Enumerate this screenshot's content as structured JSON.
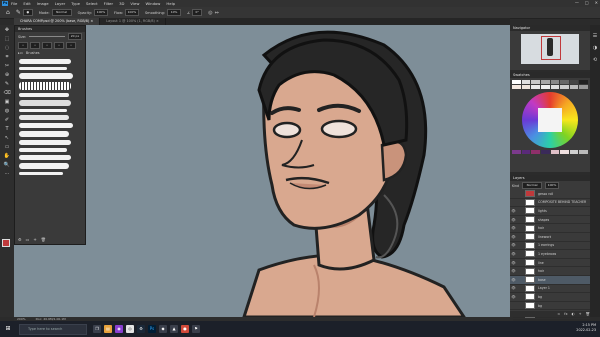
{
  "app": {
    "logo": "Ps",
    "menu": [
      "File",
      "Edit",
      "Image",
      "Layer",
      "Type",
      "Select",
      "Filter",
      "3D",
      "View",
      "Window",
      "Help"
    ],
    "window_controls": [
      "—",
      "□",
      "✕"
    ]
  },
  "options": {
    "mode_label": "Mode:",
    "mode_value": "Normal",
    "opacity_label": "Opacity:",
    "opacity_value": "100%",
    "flow_label": "Flow:",
    "flow_value": "100%",
    "smoothing_label": "Smoothing:",
    "smoothing_value": "10%",
    "angle_value": "0°"
  },
  "document_tabs": [
    {
      "label": "CHARA COMP.psd @ 200% (base, RGB/8) ×",
      "active": true
    },
    {
      "label": "Layout 1 @ 100% (1, RGB/8) ×",
      "active": false
    }
  ],
  "toolbar": [
    "✥",
    "⬚",
    "◌",
    "⌗",
    "✂",
    "⊕",
    "✎",
    "⌫",
    "▣",
    "◍",
    "✐",
    "T",
    "↖",
    "▭",
    "✋",
    "🔍",
    "⋯"
  ],
  "brushes_panel": {
    "title": "Brushes",
    "size_label": "Size:",
    "size_value": "20 px",
    "folder_label": "Brushes",
    "preset_count": 8
  },
  "navigator": {
    "title": "Navigator"
  },
  "swatches": {
    "title": "Swatches"
  },
  "layers": {
    "title": "Layers",
    "kind_label": "Kind",
    "blend_value": "Normal",
    "opacity_value": "100%",
    "rows": [
      {
        "name": "gesso roll",
        "eye": false,
        "color": "#c0393b"
      },
      {
        "name": "COMPOSITE BEHIND TEACHER",
        "eye": false,
        "color": "#4a4a4a"
      },
      {
        "name": "lights",
        "eye": true,
        "color": "#3a3a3a"
      },
      {
        "name": "shapes",
        "eye": true,
        "color": "#3a3a3a"
      },
      {
        "name": "hair",
        "eye": true,
        "color": "#3a3a3a"
      },
      {
        "name": "linework",
        "eye": true,
        "color": "#3a3a3a"
      },
      {
        "name": "1 earrings",
        "eye": true,
        "color": "#3a3a3a"
      },
      {
        "name": "1 eyebrows",
        "eye": true,
        "color": "#3a3a3a"
      },
      {
        "name": "line",
        "eye": true,
        "color": "#3a3a3a"
      },
      {
        "name": "hair",
        "eye": true,
        "color": "#3a3a3a"
      },
      {
        "name": "base",
        "eye": true,
        "color": "#5b6b7a"
      },
      {
        "name": "Layer 1",
        "eye": true,
        "color": "#3a3a3a"
      },
      {
        "name": "bg",
        "eye": true,
        "color": "#3a3a3a"
      },
      {
        "name": "bg",
        "eye": false,
        "color": "#3a3a3a"
      },
      {
        "name": "Style",
        "eye": true,
        "color": "#3a3a3a"
      }
    ]
  },
  "status": {
    "zoom": "200%",
    "doc": "Doc: 20.6M/1.00.1M"
  },
  "taskbar": {
    "search_placeholder": "Type here to search",
    "time": "2:15 PM",
    "date": "2022-02-23"
  },
  "colors": {
    "canvas_bg": "#7e8e98",
    "skin": "#d9a88f",
    "skin_shadow": "#b9826c",
    "hair": "#262626",
    "accent_blue": "#2f8fdc"
  }
}
